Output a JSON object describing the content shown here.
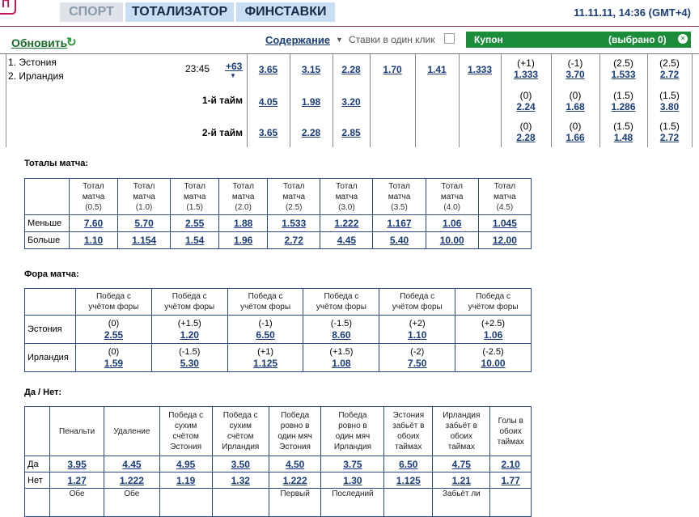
{
  "header": {
    "logo": "П",
    "nav": [
      {
        "label": "СПОРТ"
      },
      {
        "label": "ТОТАЛИЗАТОР"
      },
      {
        "label": "ФИНСТАВКИ"
      }
    ],
    "datetime": "11.11.11, 14:36 (GMT+4)"
  },
  "toolbar": {
    "refresh": "Обновить",
    "contents": "Содержание",
    "one_click": "Ставки в один клик",
    "coupon_label": "Купон",
    "coupon_count": "(выбрано 0)"
  },
  "event": {
    "team1": "1. Эстония",
    "team2": "2. Ирландия",
    "time": "23:45",
    "more": "+63",
    "rows": [
      {
        "label": "",
        "odds": [
          "3.65",
          "3.15",
          "2.28",
          "1.70",
          "1.41",
          "1.333"
        ],
        "handicaps": [
          {
            "h": "(+1)",
            "v": "1.333"
          },
          {
            "h": "(-1)",
            "v": "3.70"
          },
          {
            "h": "(2.5)",
            "v": "1.533"
          },
          {
            "h": "(2.5)",
            "v": "2.72"
          }
        ]
      },
      {
        "label": "1-й тайм",
        "odds": [
          "4.05",
          "1.98",
          "3.20"
        ],
        "handicaps": [
          {
            "h": "(0)",
            "v": "2.24"
          },
          {
            "h": "(0)",
            "v": "1.68"
          },
          {
            "h": "(1.5)",
            "v": "1.286"
          },
          {
            "h": "(1.5)",
            "v": "3.80"
          }
        ]
      },
      {
        "label": "2-й тайм",
        "odds": [
          "3.65",
          "2.28",
          "2.85"
        ],
        "handicaps": [
          {
            "h": "(0)",
            "v": "2.28"
          },
          {
            "h": "(0)",
            "v": "1.66"
          },
          {
            "h": "(1.5)",
            "v": "1.48"
          },
          {
            "h": "(1.5)",
            "v": "2.72"
          }
        ]
      }
    ]
  },
  "totals": {
    "title": "Тоталы матча:",
    "head_word1": "Тотал",
    "head_word2": "матча",
    "lines": [
      "(0.5)",
      "(1.0)",
      "(1.5)",
      "(2.0)",
      "(2.5)",
      "(3.0)",
      "(3.5)",
      "(4.0)",
      "(4.5)"
    ],
    "rows": [
      {
        "label": "Меньше",
        "values": [
          "7.60",
          "5.70",
          "2.55",
          "1.88",
          "1.533",
          "1.222",
          "1.167",
          "1.06",
          "1.045"
        ]
      },
      {
        "label": "Больше",
        "values": [
          "1.10",
          "1.154",
          "1.54",
          "1.96",
          "2.72",
          "4.45",
          "5.40",
          "10.00",
          "12.00"
        ]
      }
    ]
  },
  "handicap": {
    "title": "Фора матча:",
    "head_line1": "Победа с",
    "head_line2": "учётом форы",
    "rows": [
      {
        "label": "Эстония",
        "cells": [
          {
            "h": "(0)",
            "v": "2.55"
          },
          {
            "h": "(+1.5)",
            "v": "1.20"
          },
          {
            "h": "(-1)",
            "v": "6.50"
          },
          {
            "h": "(-1.5)",
            "v": "8.60"
          },
          {
            "h": "(+2)",
            "v": "1.10"
          },
          {
            "h": "(+2.5)",
            "v": "1.06"
          }
        ]
      },
      {
        "label": "Ирландия",
        "cells": [
          {
            "h": "(0)",
            "v": "1.59"
          },
          {
            "h": "(-1.5)",
            "v": "5.30"
          },
          {
            "h": "(+1)",
            "v": "1.125"
          },
          {
            "h": "(+1.5)",
            "v": "1.08"
          },
          {
            "h": "(-2)",
            "v": "7.50"
          },
          {
            "h": "(-2.5)",
            "v": "10.00"
          }
        ]
      }
    ]
  },
  "yesno": {
    "title": "Да / Нет:",
    "headers": [
      [
        "Пенальти"
      ],
      [
        "Удаление"
      ],
      [
        "Победа с",
        "сухим",
        "счётом",
        "Эстония"
      ],
      [
        "Победа с",
        "сухим",
        "счётом",
        "Ирландия"
      ],
      [
        "Победа",
        "ровно в",
        "один мяч",
        "Эстония"
      ],
      [
        "Победа",
        "ровно в",
        "один мяч",
        "Ирландия"
      ],
      [
        "Эстония",
        "забьёт в",
        "обоих",
        "таймах"
      ],
      [
        "Ирландия",
        "забьёт в",
        "обоих",
        "таймах"
      ],
      [
        "Голы в",
        "обоих",
        "таймах"
      ]
    ],
    "rows": [
      {
        "label": "Да",
        "values": [
          "3.95",
          "4.45",
          "4.95",
          "3.50",
          "4.50",
          "3.75",
          "6.50",
          "4.75",
          "2.10"
        ]
      },
      {
        "label": "Нет",
        "values": [
          "1.27",
          "1.222",
          "1.19",
          "1.32",
          "1.222",
          "1.30",
          "1.125",
          "1.21",
          "1.77"
        ]
      }
    ],
    "next_headers": [
      [
        "Обе"
      ],
      [
        "Обе"
      ],
      [
        ""
      ],
      [
        ""
      ],
      [
        "Первый"
      ],
      [
        "Последний"
      ],
      [
        ""
      ],
      [
        "Забьёт ли"
      ],
      [
        ""
      ]
    ]
  },
  "colors": {
    "accent": "#1a3d7a",
    "coupon": "#1a8c3a",
    "nav_bg": "#c8def2",
    "brand": "#c2185b"
  }
}
